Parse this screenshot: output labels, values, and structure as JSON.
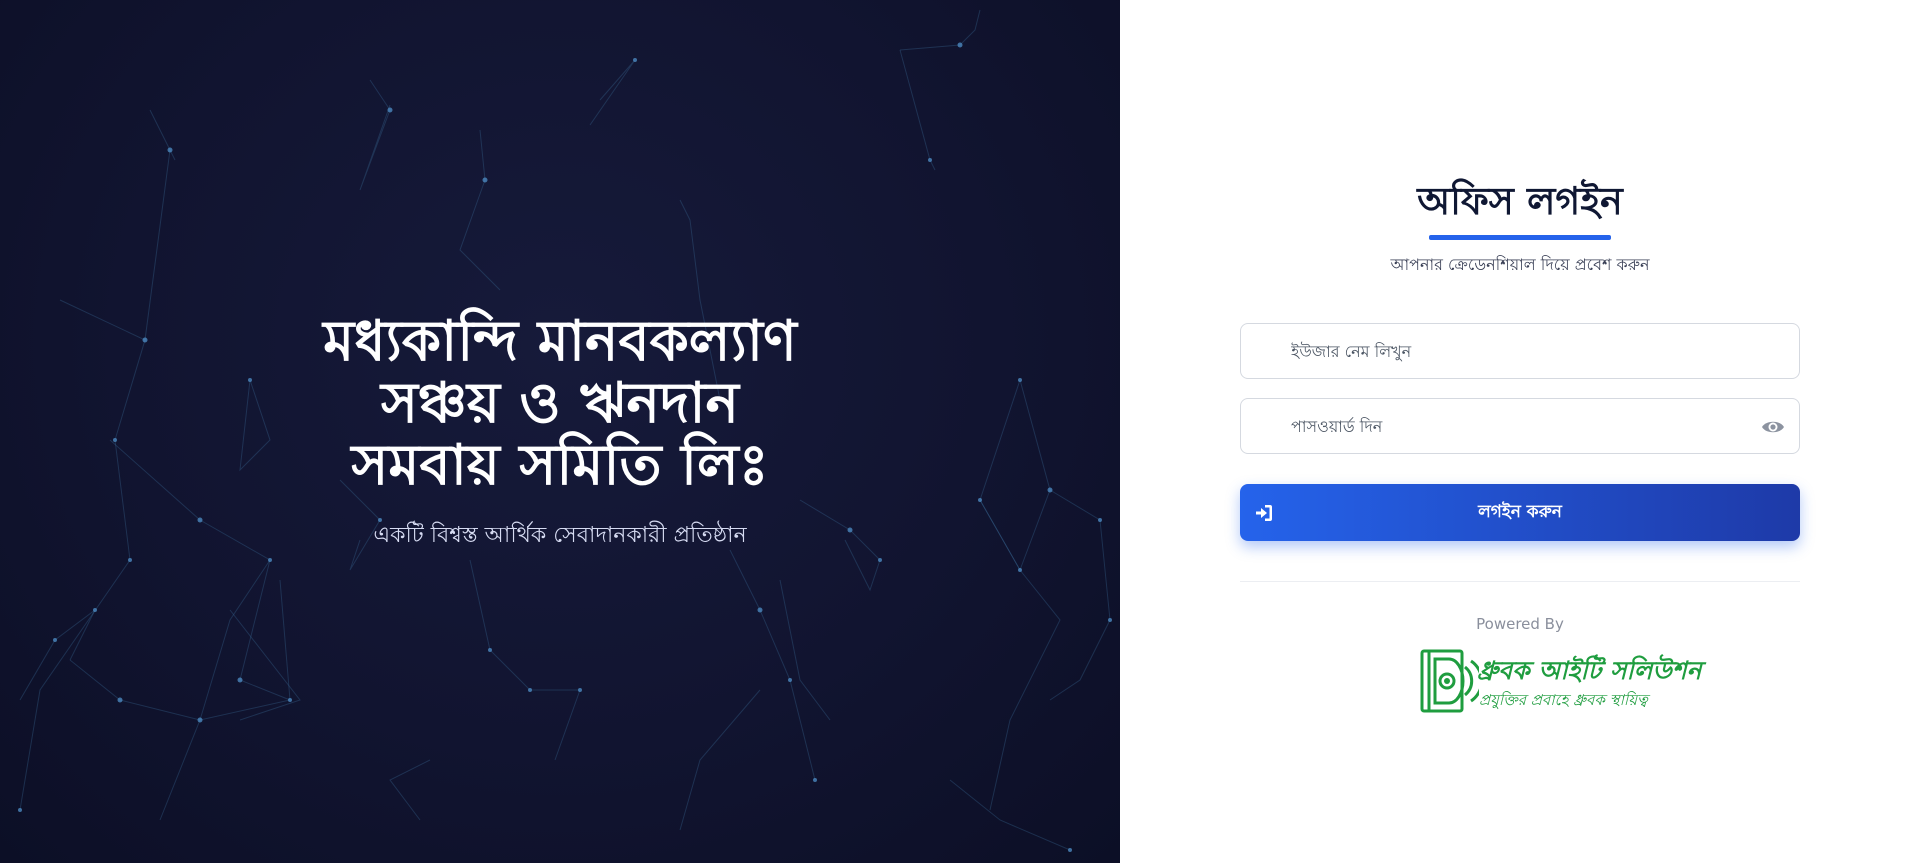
{
  "hero": {
    "title_line1": "মধ্যকান্দি মানবকল্যাণ",
    "title_line2": "সঞ্চয় ও ঋনদান",
    "title_line3": "সমবায় সমিতি লিঃ",
    "subtitle": "একটি বিশ্বস্ত আর্থিক সেবাদানকারী প্রতিষ্ঠান"
  },
  "login": {
    "title": "অফিস লগইন",
    "subtitle": "আপনার ক্রেডেনশিয়াল দিয়ে প্রবেশ করুন",
    "username": {
      "value": "",
      "placeholder": "ইউজার নেম লিখুন"
    },
    "password": {
      "value": "",
      "placeholder": "পাসওয়ার্ড দিন",
      "toggle_icon": "eye-icon"
    },
    "submit": {
      "label": "লগইন করুন",
      "icon": "sign-in-icon"
    },
    "powered_by": "Powered By",
    "brand": {
      "name": "ধ্রুবক আইটি সলিউশন",
      "tagline": "প্রযুক্তির প্রবাহে ধ্রুবক স্থায়িত্ব",
      "color": "#1f9d3f"
    }
  },
  "colors": {
    "hero_background": "#111430",
    "accent": "#2563eb",
    "button_gradient_end": "#1e3aa8",
    "title_text": "#0f1733"
  }
}
